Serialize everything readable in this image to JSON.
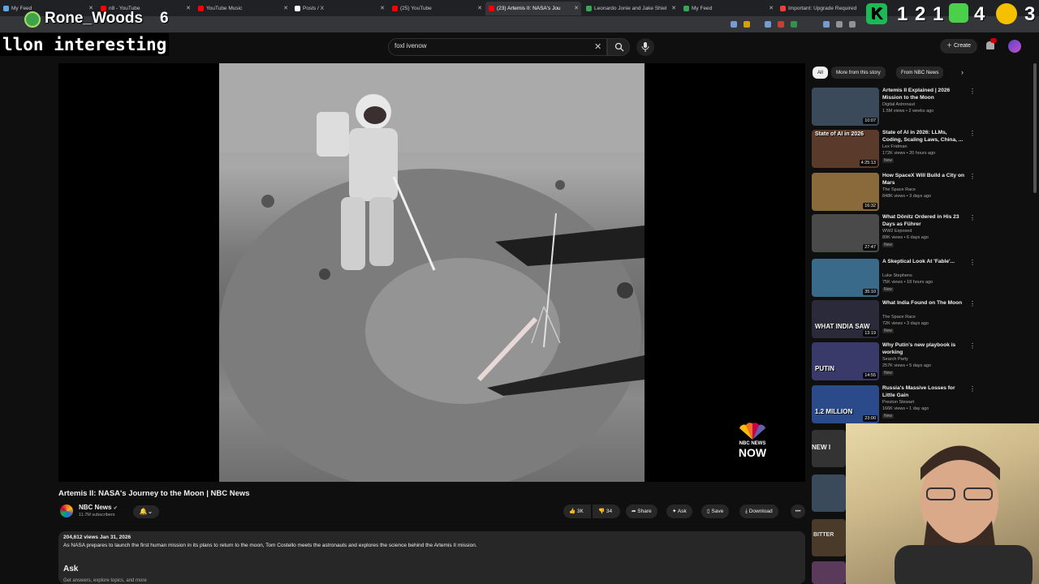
{
  "browser": {
    "tabs": [
      {
        "title": "My Feed",
        "color": "#5aa9e6"
      },
      {
        "title": "n8 - YouTube",
        "color": "#ff0000"
      },
      {
        "title": "YouTube Music",
        "color": "#ff0000"
      },
      {
        "title": "Posts / X",
        "color": "#ffffff"
      },
      {
        "title": "(25) YouTube",
        "color": "#ff0000"
      },
      {
        "title": "(23) Artemis II: NASA's Jou",
        "color": "#ff0000"
      },
      {
        "title": "Leonardo Jonie and Jake Shiel",
        "color": "#34a853"
      },
      {
        "title": "My Feed",
        "color": "#34a853"
      },
      {
        "title": "Important: Upgrade Required",
        "color": "#ea4335"
      }
    ],
    "active_tab_index": 5
  },
  "overlays": {
    "username": "Rone_Woods",
    "user_number": "6",
    "chat_text": "llon interesting",
    "counter_digits": [
      "1",
      "2",
      "1",
      "4",
      "3"
    ]
  },
  "header": {
    "search_value": "foxl ivenow",
    "create_label": "Create"
  },
  "video": {
    "title": "Artemis II: NASA's Journey to the Moon | NBC News",
    "watermark_line1": "NBC NEWS",
    "watermark_line2": "NOW",
    "channel": "NBC News",
    "subscribers": "11.7M subscribers",
    "likes": "3K",
    "dislikes": "34",
    "share_label": "Share",
    "ask_label": "Ask",
    "save_label": "Save",
    "download_label": "Download",
    "more_label": "•••",
    "views_date": "204,612 views  Jan 31, 2026",
    "description": "As NASA prepares to launch the first human mission in its plans to return to the moon, Tom Costello meets the astronauts and explores the science behind the Artemis II mission.",
    "ask_heading": "Ask",
    "ask_subtext": "Get answers, explore topics, and more"
  },
  "sidebar": {
    "chips": [
      "All",
      "More from this story",
      "From NBC News"
    ],
    "recommendations": [
      {
        "title": "Artemis II Explained | 2026 Mission to the Moon",
        "channel": "Digital Astronaut",
        "meta": "1.5M views • 2 weeks ago",
        "duration": "10:07",
        "new": false,
        "thumb": "#3a4a5a"
      },
      {
        "title": "State of AI in 2026: LLMs, Coding, Scaling Laws, China, ...",
        "channel": "Lex Fridman",
        "meta": "172K views • 20 hours ago",
        "duration": "4:25:13",
        "new": true,
        "thumb": "#5a3a2a"
      },
      {
        "title": "How SpaceX Will Build a City on Mars",
        "channel": "The Space Race",
        "meta": "848K views • 3 days ago",
        "duration": "16:32",
        "new": false,
        "thumb": "#8a6a3a"
      },
      {
        "title": "What Dönitz Ordered in His 23 Days as Führer",
        "channel": "WW2 Exposed",
        "meta": "89K views • 6 days ago",
        "duration": "27:47",
        "new": true,
        "thumb": "#4a4a4a"
      },
      {
        "title": "A Skeptical Look At 'Fable'...",
        "channel": "Luke Stephens",
        "meta": "75K views • 18 hours ago",
        "duration": "35:10",
        "new": true,
        "thumb": "#3a6a8a"
      },
      {
        "title": "What India Found on The Moon",
        "channel": "The Space Race",
        "meta": "72K views • 3 days ago",
        "duration": "13:19",
        "new": true,
        "thumb": "#2a2a3a"
      },
      {
        "title": "Why Putin's new playbook is working",
        "channel": "Search Party",
        "meta": "257K views • 5 days ago",
        "duration": "14:55",
        "new": true,
        "thumb": "#3a3a6a"
      },
      {
        "title": "Russia's Massive Losses for Little Gain",
        "channel": "Preston Stewart",
        "meta": "166K views • 1 day ago",
        "duration": "23:00",
        "new": true,
        "thumb": "#2a4a8a"
      }
    ],
    "thumb_captions": [
      "",
      "State of AI in 2026",
      "",
      "",
      "",
      "WHAT INDIA SAW",
      "PUTIN",
      "1.2 MILLION"
    ]
  },
  "partial_thumbs": [
    "NEW I",
    "",
    "BITTER"
  ],
  "new_label": "New"
}
